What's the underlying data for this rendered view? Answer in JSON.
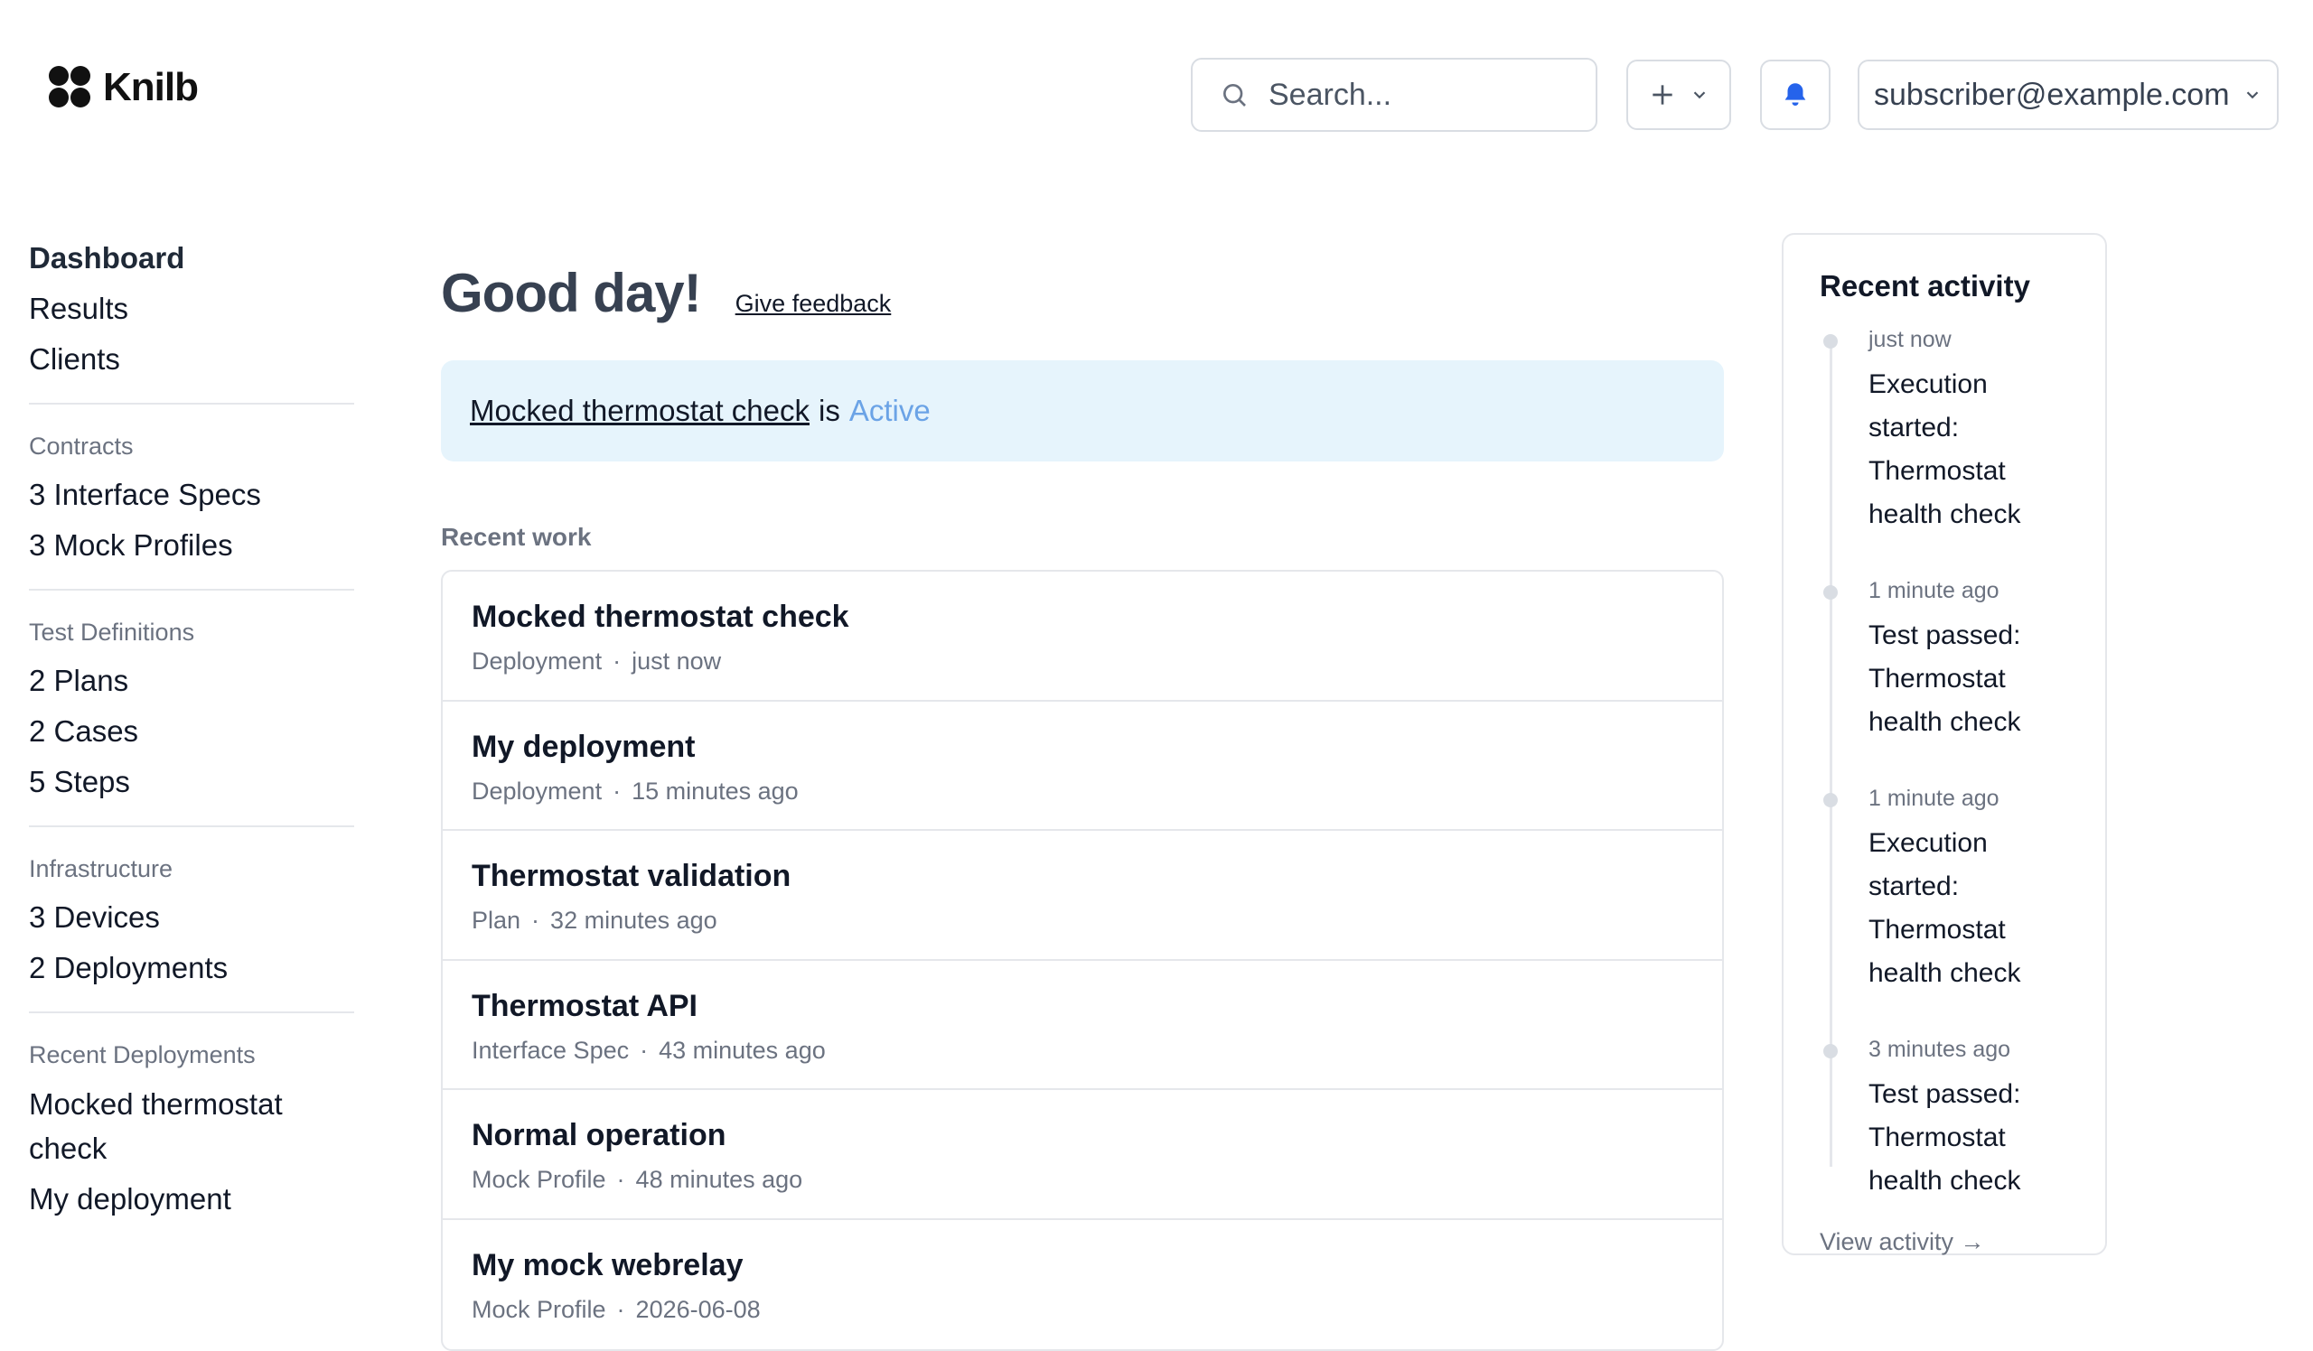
{
  "brand": {
    "name": "Knilb"
  },
  "header": {
    "search_placeholder": "Search...",
    "user_email": "subscriber@example.com"
  },
  "sidebar": {
    "top_items": [
      "Dashboard",
      "Results",
      "Clients"
    ],
    "groups": [
      {
        "label": "Contracts",
        "items": [
          "3 Interface Specs",
          "3 Mock Profiles"
        ]
      },
      {
        "label": "Test Definitions",
        "items": [
          "2 Plans",
          "2 Cases",
          "5 Steps"
        ]
      },
      {
        "label": "Infrastructure",
        "items": [
          "3 Devices",
          "2 Deployments"
        ]
      },
      {
        "label": "Recent Deployments",
        "items": [
          "Mocked thermostat check",
          "My deployment"
        ]
      }
    ]
  },
  "main": {
    "greeting": "Good day!",
    "feedback_label": "Give feedback",
    "banner": {
      "link_text": "Mocked thermostat check",
      "connector": "is",
      "status": "Active"
    },
    "recent_work_title": "Recent work",
    "recent_work": [
      {
        "title": "Mocked thermostat check",
        "type": "Deployment",
        "time": "just now"
      },
      {
        "title": "My deployment",
        "type": "Deployment",
        "time": "15 minutes ago"
      },
      {
        "title": "Thermostat validation",
        "type": "Plan",
        "time": "32 minutes ago"
      },
      {
        "title": "Thermostat API",
        "type": "Interface Spec",
        "time": "43 minutes ago"
      },
      {
        "title": "Normal operation",
        "type": "Mock Profile",
        "time": "48 minutes ago"
      },
      {
        "title": "My mock webrelay",
        "type": "Mock Profile",
        "time": "2026-06-08"
      }
    ],
    "meta_separator": "·"
  },
  "activity": {
    "title": "Recent activity",
    "events": [
      {
        "time": "just now",
        "text": "Execution started: Thermostat health check"
      },
      {
        "time": "1 minute ago",
        "text": "Test passed: Thermostat health check"
      },
      {
        "time": "1 minute ago",
        "text": "Execution started: Thermostat health check"
      },
      {
        "time": "3 minutes ago",
        "text": "Test passed: Thermostat health check"
      }
    ],
    "view_label": "View activity →"
  },
  "colors": {
    "banner_bg": "#e6f4fc",
    "status_active": "#6ba3e6",
    "bell": "#2563eb"
  }
}
